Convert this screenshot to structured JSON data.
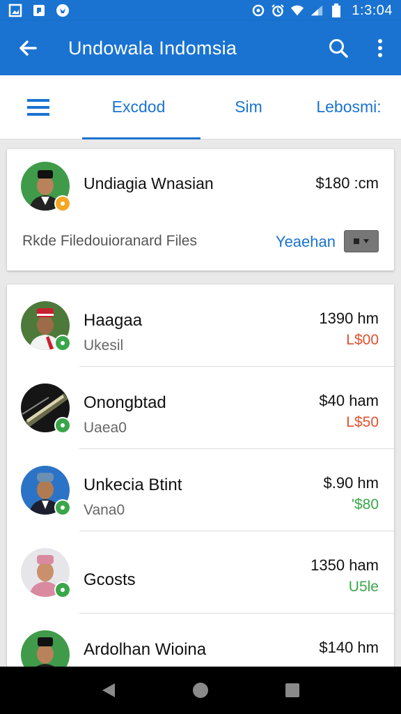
{
  "status_bar": {
    "time": "1:3:04"
  },
  "app_bar": {
    "title": "Undowala Indomsia"
  },
  "tabs": [
    {
      "label": "Excdod",
      "active": true
    },
    {
      "label": "Sim",
      "active": false
    },
    {
      "label": "Lebosmi:",
      "active": false
    }
  ],
  "top_card": {
    "name": "Undiagia Wnasian",
    "amount": "$180 :cm",
    "subtitle": "Rkde Filedouioranard Files",
    "link": "Yeaehan",
    "badge_color": "#f5a623"
  },
  "list": [
    {
      "name": "Haagaa",
      "subtitle": "Ukesil",
      "amount": "1390 hm",
      "status": "L$00",
      "status_color": "#e2512f",
      "badge_color": "#3aa64a"
    },
    {
      "name": "Onongbtad",
      "subtitle": "Uaea0",
      "amount": "$40 ham",
      "status": "L$50",
      "status_color": "#e2512f",
      "badge_color": "#3aa64a"
    },
    {
      "name": "Unkecia Btint",
      "subtitle": "Vana0",
      "amount": "$.90 hm",
      "status": "'$80",
      "status_color": "#3aa64a",
      "badge_color": "#3aa64a"
    },
    {
      "name": "Gcosts",
      "subtitle": "",
      "amount": "1350 ham",
      "status": "U5le",
      "status_color": "#3aa64a",
      "badge_color": "#3aa64a"
    },
    {
      "name": "Ardolhan Wioina",
      "subtitle": "",
      "amount": "$140 hm",
      "status": "",
      "status_color": "#e8c22a",
      "badge_color": "#3aa64a"
    }
  ],
  "colors": {
    "primary": "#1a73d1",
    "negative": "#e2512f",
    "positive": "#3aa64a"
  }
}
